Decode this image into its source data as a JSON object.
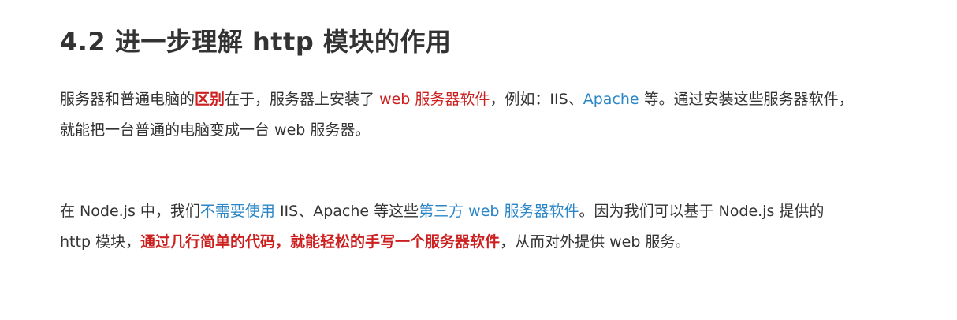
{
  "colors": {
    "text": "#333333",
    "red_highlight": "#cc2020",
    "blue_highlight": "#2a86c6",
    "background": "#ffffff"
  },
  "title": "4.2 进一步理解 http 模块的作用",
  "paragraph1": {
    "line1": {
      "s1": "服务器和普通电脑的",
      "s2": "区别",
      "s3": "在于，服务器上安装了 ",
      "s4": "web 服务器软件",
      "s5": "，例如：IIS、",
      "s6": "Apache",
      "s7": " 等。通过安装这些服务器软件，"
    },
    "line2": {
      "s1": "就能把一台普通的电脑变成一台 web 服务器。"
    }
  },
  "paragraph2": {
    "line1": {
      "s1": "在 Node.js 中，我们",
      "s2": "不需要使用",
      "s3": " IIS、Apache 等这些",
      "s4": "第三方 web 服务器软件",
      "s5": "。因为我们可以基于 Node.js 提供的"
    },
    "line2": {
      "s1": "http 模块，",
      "s2": "通过几行简单的代码，就能轻松的手写一个服务器软件",
      "s3": "，从而对外提供 web 服务。"
    }
  }
}
